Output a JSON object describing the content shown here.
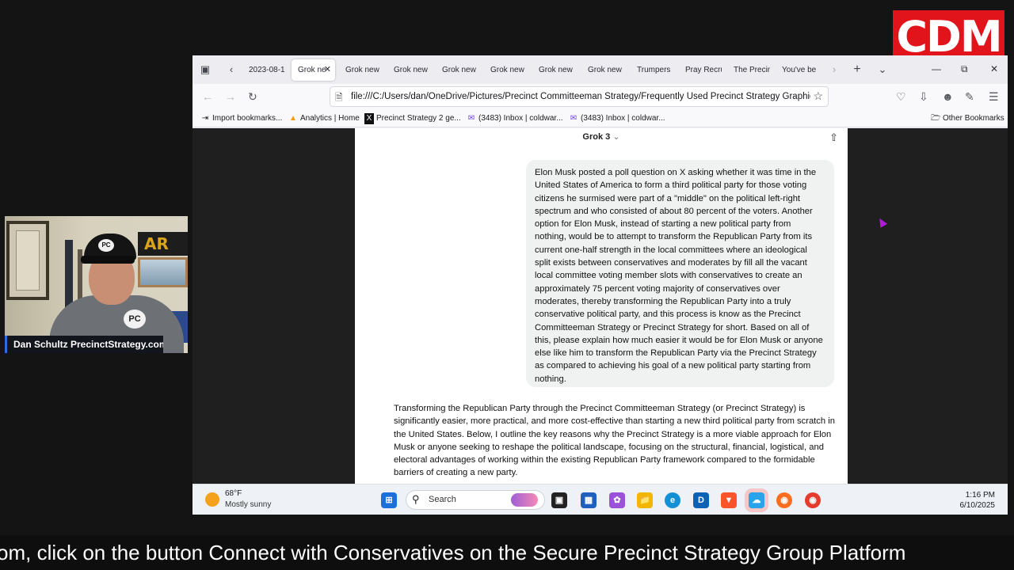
{
  "logo": {
    "text": "CDM"
  },
  "webcam": {
    "caption": "Dan Schultz PrecinctStrategy.com",
    "pennant_text": "AR",
    "cap_badge": "PC",
    "shirt_badge": "PC"
  },
  "browser": {
    "tabs": [
      {
        "label": "2023-08-1",
        "active": false
      },
      {
        "label": "Grok ne",
        "active": true
      },
      {
        "label": "Grok new",
        "active": false
      },
      {
        "label": "Grok new",
        "active": false
      },
      {
        "label": "Grok new",
        "active": false
      },
      {
        "label": "Grok new",
        "active": false
      },
      {
        "label": "Grok new",
        "active": false
      },
      {
        "label": "Grok new",
        "active": false
      },
      {
        "label": "Trumpers",
        "active": false
      },
      {
        "label": "Pray Recru",
        "active": false
      },
      {
        "label": "The Precin",
        "active": false
      },
      {
        "label": "You've be",
        "active": false
      }
    ],
    "url": "file:///C:/Users/dan/OneDrive/Pictures/Precinct Committeeman Strategy/Frequently Used Precinct Strategy Graphics/C",
    "bookmarks": [
      {
        "label": "Import bookmarks...",
        "icon": "import-icon"
      },
      {
        "label": "Analytics | Home",
        "icon": "analytics-icon"
      },
      {
        "label": "Precinct Strategy 2 ge...",
        "icon": "x-icon"
      },
      {
        "label": "(3483) Inbox | coldwar...",
        "icon": "mail-icon"
      },
      {
        "label": "(3483) Inbox | coldwar...",
        "icon": "mail-icon"
      }
    ],
    "other_bookmarks": "Other Bookmarks"
  },
  "chat": {
    "header": "Grok 3",
    "user_message": "Elon Musk posted a poll question on X asking whether it was time in the United States of America to form a third political party for those voting citizens he surmised were part of a \"middle\" on the political left-right spectrum and who consisted of about 80 percent of the voters.  Another option for Elon Musk, instead of starting a new political party from nothing, would be to attempt to transform the Republican Party from its current one-half strength in the local committees where an ideological split exists between conservatives and moderates by fill all the vacant local committee voting member slots with conservatives to create an approximately 75 percent voting majority of conservatives over moderates, thereby transforming the Republican Party into a truly conservative political party, and this process is know as the Precinct Committeeman Strategy or Precinct Strategy for short.  Based on all of this, please explain how much easier it would be for Elon Musk or anyone else like him to transform the Republican Party via the Precinct Strategy as compared to achieving his goal of a new political party starting from nothing.",
    "reply": "Transforming the Republican Party through the Precinct Committeeman Strategy (or Precinct Strategy) is significantly easier, more practical, and more cost-effective than starting a new third political party from scratch in the United States. Below, I outline the key reasons why the Precinct Strategy is a more viable approach for Elon Musk or anyone seeking to reshape the political landscape, focusing on the structural, financial, logistical, and electoral advantages of working within the existing Republican Party framework compared to the formidable barriers of creating a new party."
  },
  "taskbar": {
    "temperature": "68°F",
    "condition": "Mostly sunny",
    "search_label": "Search",
    "time": "1:16 PM",
    "date": "6/10/2025"
  },
  "ticker": {
    "text": "om, click on the button Connect with Conservatives on the Secure Precinct Strategy Group Platform"
  }
}
